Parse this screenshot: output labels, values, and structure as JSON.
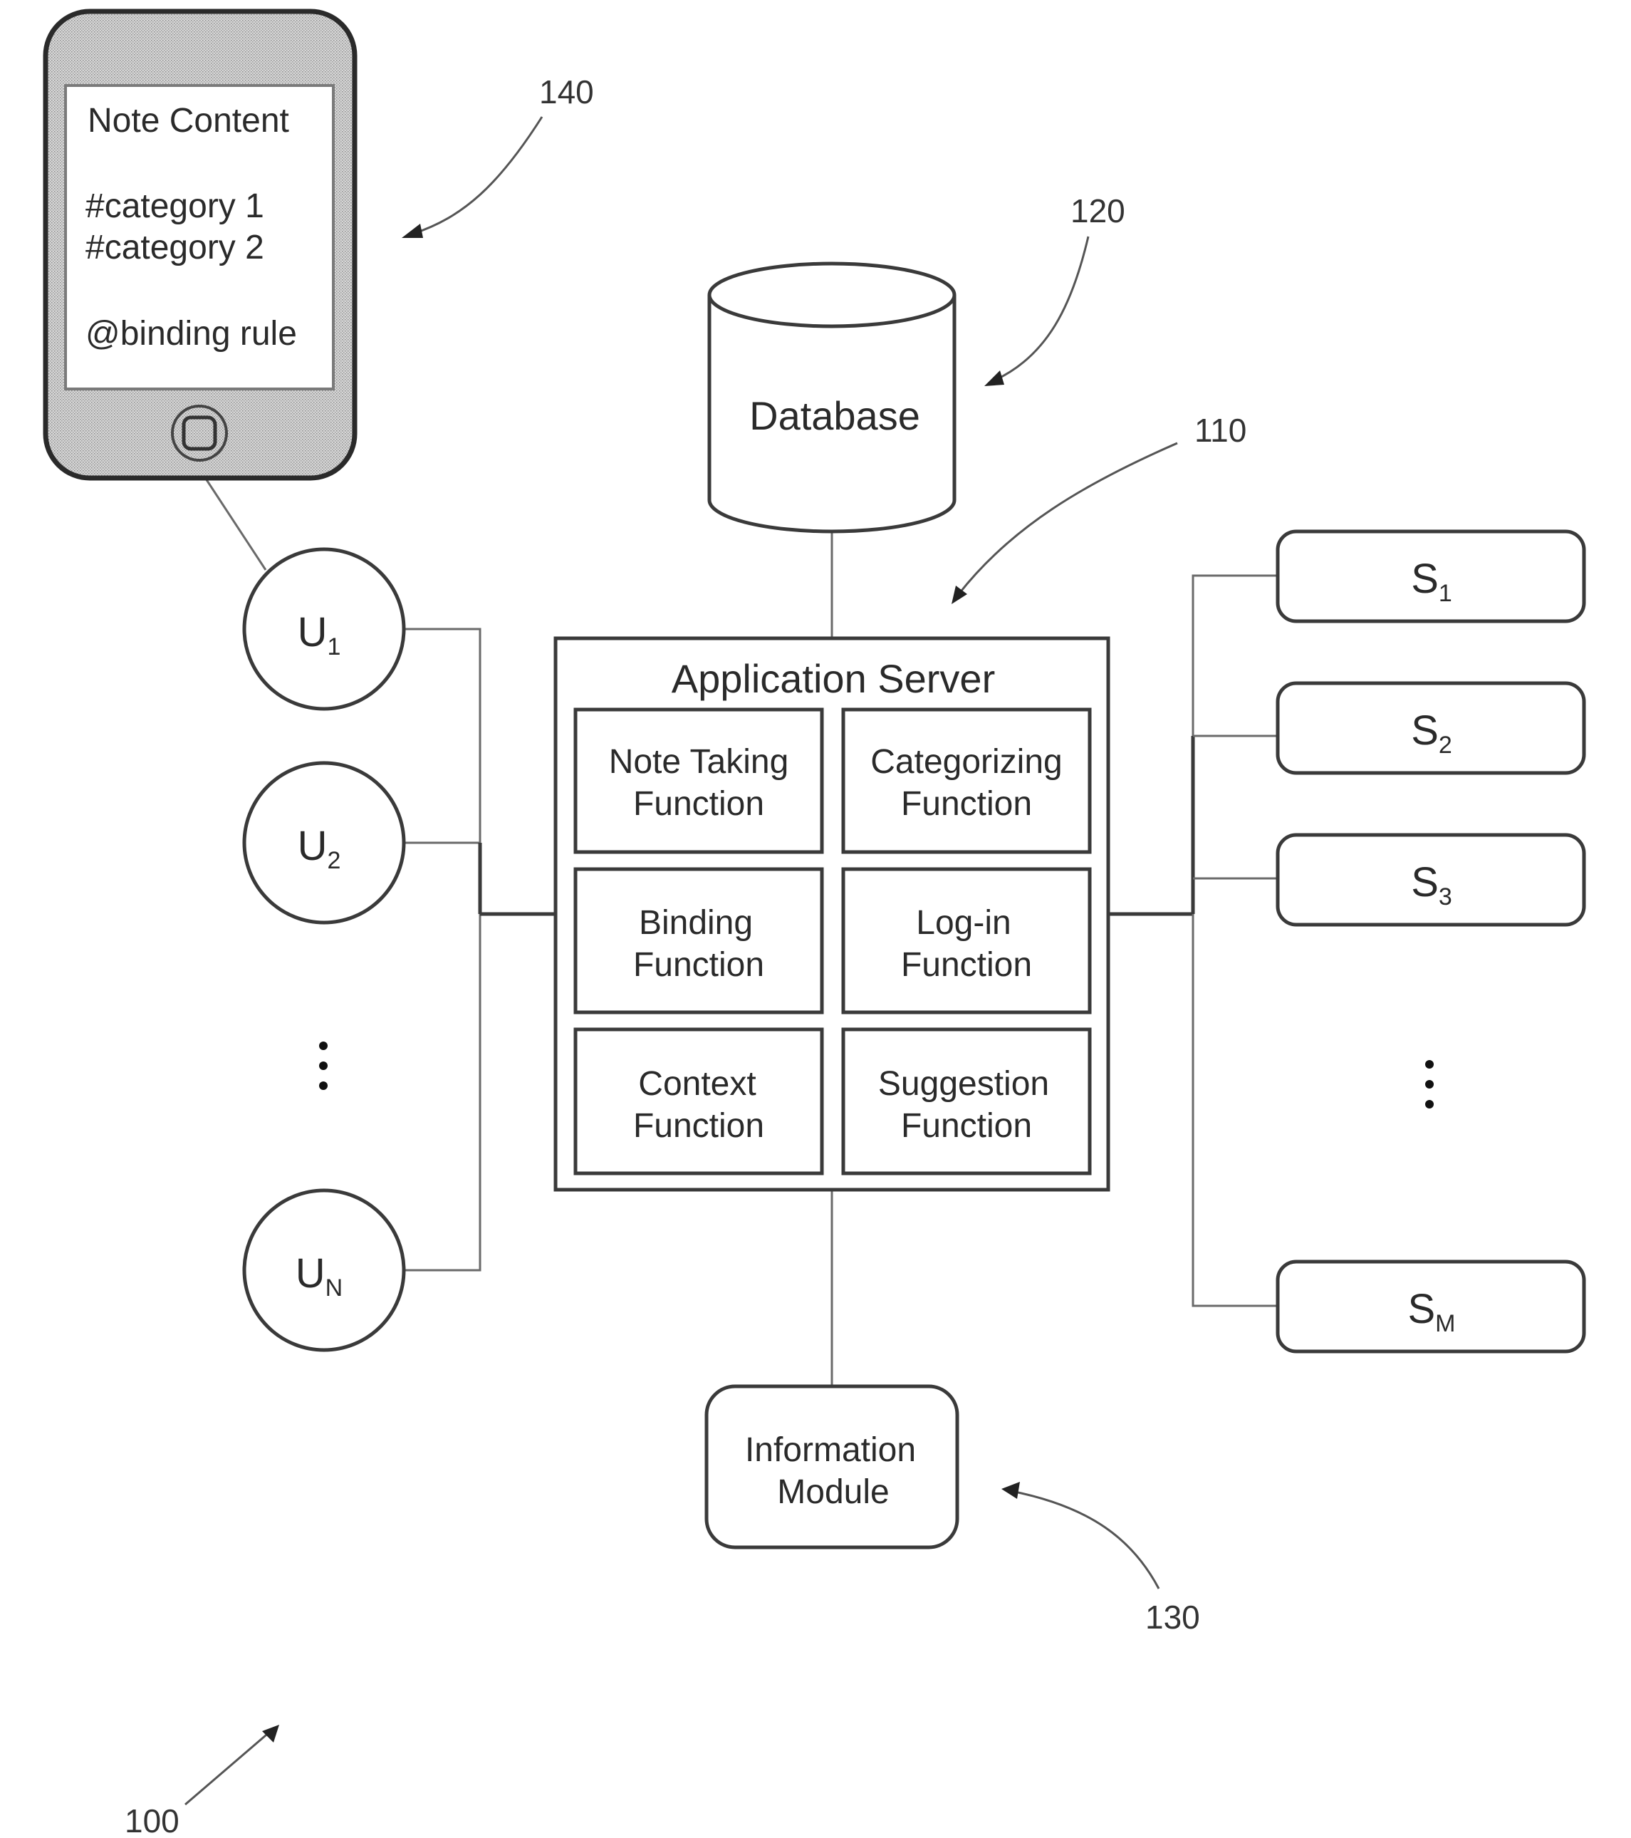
{
  "figure": {
    "system_ref": "100",
    "colors": {
      "stroke": "#3a3a3a",
      "phone_body": "#cfcfcf",
      "background": "#ffffff"
    }
  },
  "phone": {
    "ref": "140",
    "screen_lines": [
      "Note Content",
      "#category 1",
      "#category 2",
      "@binding rule"
    ],
    "icon": "smartphone-icon"
  },
  "database": {
    "ref": "120",
    "label": "Database",
    "icon": "cylinder-database-icon"
  },
  "app_server": {
    "ref": "110",
    "title": "Application Server",
    "functions": [
      {
        "line1": "Note Taking",
        "line2": "Function"
      },
      {
        "line1": "Categorizing",
        "line2": "Function"
      },
      {
        "line1": "Binding",
        "line2": "Function"
      },
      {
        "line1": "Log-in",
        "line2": "Function"
      },
      {
        "line1": "Context",
        "line2": "Function"
      },
      {
        "line1": "Suggestion",
        "line2": "Function"
      }
    ]
  },
  "info_module": {
    "ref": "130",
    "line1": "Information",
    "line2": "Module"
  },
  "users": [
    {
      "base": "U",
      "sub": "1"
    },
    {
      "base": "U",
      "sub": "2"
    },
    {
      "base": "U",
      "sub": "N"
    }
  ],
  "users_ellipsis": "⋮",
  "servers": [
    {
      "base": "S",
      "sub": "1"
    },
    {
      "base": "S",
      "sub": "2"
    },
    {
      "base": "S",
      "sub": "3"
    },
    {
      "base": "S",
      "sub": "M"
    }
  ],
  "servers_ellipsis": "⋮"
}
